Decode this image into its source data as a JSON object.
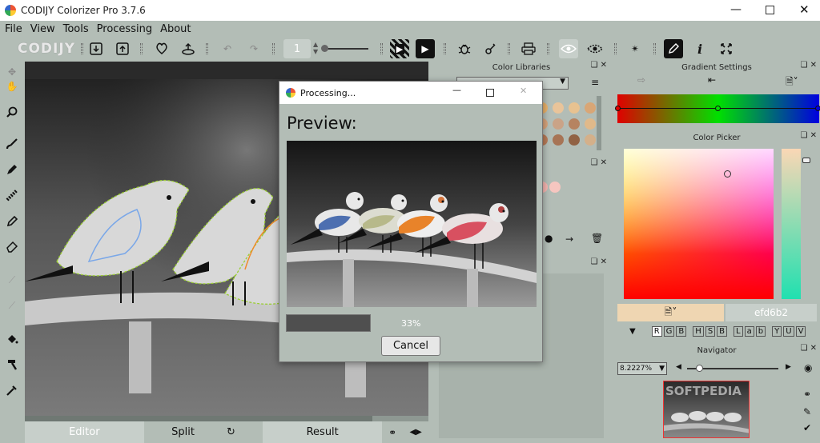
{
  "window": {
    "title": "CODIJY Colorizer Pro 3.7.6"
  },
  "menu": [
    "File",
    "View",
    "Tools",
    "Processing",
    "About"
  ],
  "toolbar": {
    "logo": "CODIJY",
    "brush_size": "1"
  },
  "panels": {
    "color_libraries": "Color Libraries",
    "gradient_settings": "Gradient Settings",
    "color_picker": "Color Picker",
    "navigator": "Navigator"
  },
  "color_picker": {
    "hex": "efd6b2",
    "modes": [
      "R",
      "G",
      "B",
      "H",
      "S",
      "B",
      "L",
      "a",
      "b",
      "Y",
      "U",
      "V"
    ]
  },
  "navigator": {
    "zoom": "8.2227%",
    "watermark": "SOFTPEDIA"
  },
  "dialog": {
    "title": "Processing...",
    "heading": "Preview:",
    "progress_label": "33%",
    "progress": 0.33,
    "cancel": "Cancel"
  },
  "tabs": {
    "editor": "Editor",
    "split": "Split",
    "result": "Result"
  },
  "colors": {
    "accent": "#efd6b2"
  }
}
